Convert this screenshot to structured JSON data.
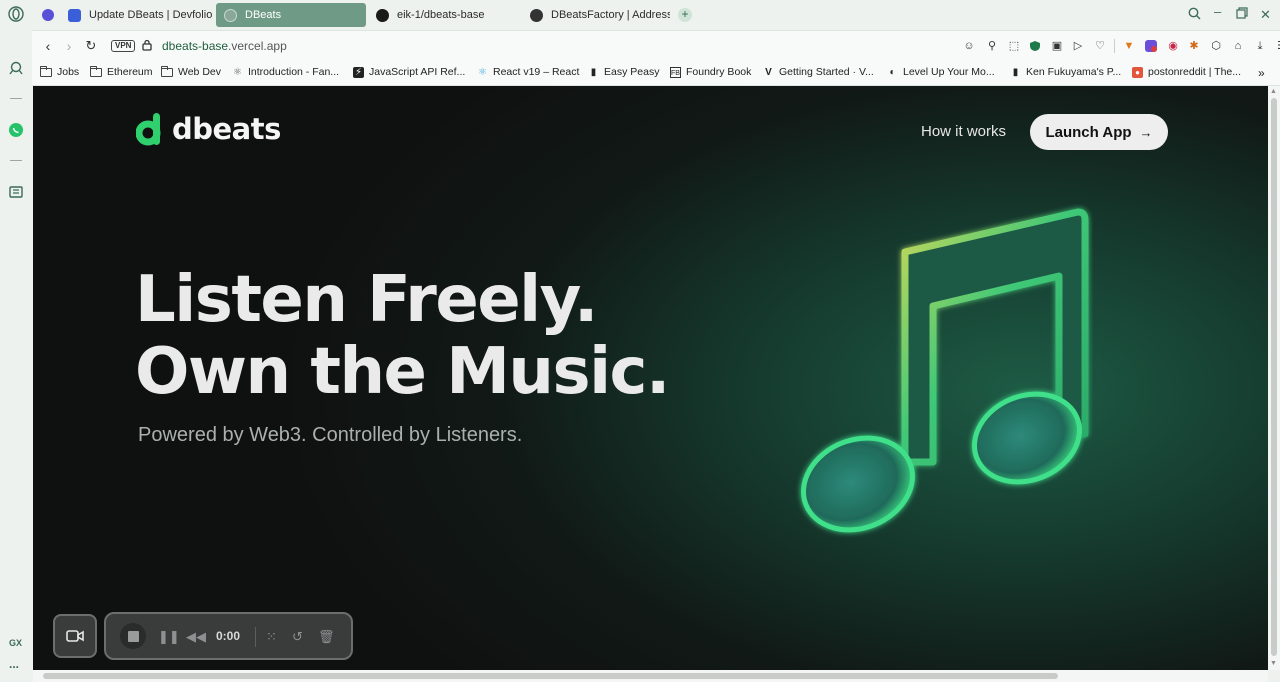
{
  "tabs": [
    {
      "label": "Update DBeats | Devfolio",
      "fav_color": "#3a5fd9",
      "active": false
    },
    {
      "label": "DBeats",
      "fav_color": "#8aa89a",
      "active": true
    },
    {
      "label": "eik-1/dbeats-base",
      "fav_color": "#1a1a1a",
      "active": false
    },
    {
      "label": "DBeatsFactory | Address",
      "fav_color": "#333333",
      "active": false
    }
  ],
  "address": {
    "vpn": "VPN",
    "host": "dbeats-base",
    "domain": ".vercel.app"
  },
  "bookmarks": [
    {
      "label": "Jobs",
      "icon": "folder-icon"
    },
    {
      "label": "Ethereum",
      "icon": "folder-icon"
    },
    {
      "label": "Web Dev",
      "icon": "folder-icon"
    },
    {
      "label": "Introduction - Fan...",
      "icon": "react-icon"
    },
    {
      "label": "JavaScript API Ref...",
      "icon": "bolt-icon"
    },
    {
      "label": "React v19 – React",
      "icon": "react-icon"
    },
    {
      "label": "Easy Peasy",
      "icon": "page-icon"
    },
    {
      "label": "Foundry Book",
      "icon": "book-icon"
    },
    {
      "label": "Getting Started · V...",
      "icon": "v-icon"
    },
    {
      "label": "Level Up Your Mo...",
      "icon": "circle-icon"
    },
    {
      "label": "Ken Fukuyama's P...",
      "icon": "page-icon"
    },
    {
      "label": "postonreddit | The...",
      "icon": "reddit-icon"
    }
  ],
  "sidebar": {
    "bottom_label": "GX",
    "more": "..."
  },
  "site": {
    "brand": "dbeats",
    "nav_how": "How it works",
    "cta": "Launch App",
    "cta_arrow": "→",
    "headline_1": "Listen Freely.",
    "headline_2": "Own the Music.",
    "subline": "Powered by Web3. Controlled by Listeners.",
    "brand_color": "#2fd06d"
  },
  "recorder": {
    "time": "0:00"
  }
}
